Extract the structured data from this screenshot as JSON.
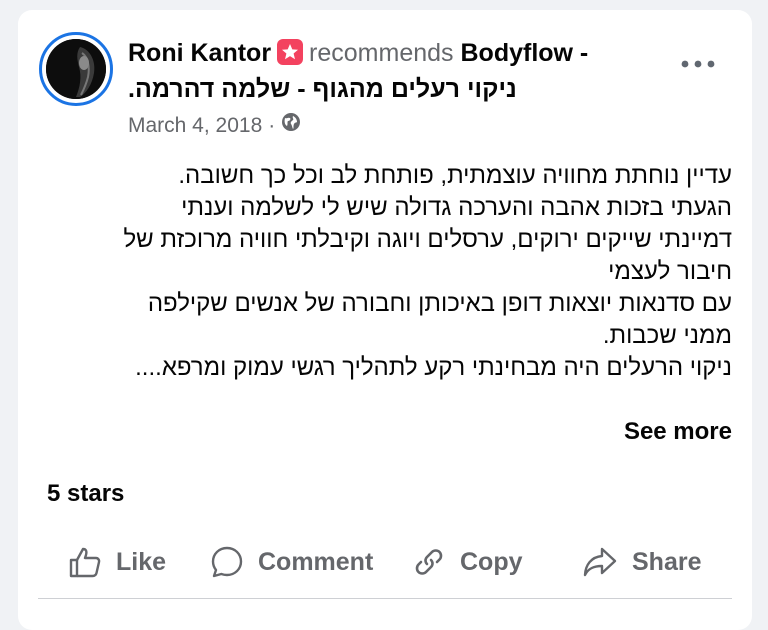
{
  "post": {
    "author": "Roni Kantor",
    "recommends_text": "recommends",
    "page_name_line1": "Bodyflow -",
    "page_name_line2": "ניקוי רעלים מהגוף - שלמה דהרמה.",
    "date": "March 4, 2018",
    "separator": "·",
    "privacy_icon": "globe-icon",
    "more_icon": "more-horizontal-icon",
    "body_lines": [
      "עדיין נוחתת מחוויה עוצמתית, פותחת לב וכל כך חשובה.",
      "הגעתי בזכות אהבה והערכה גדולה שיש לי לשלמה וענתי",
      "דמיינתי שייקים ירוקים, ערסלים ויוגה וקיבלתי חוויה מרוכזת של",
      "חיבור לעצמי",
      "עם סדנאות יוצאות דופן באיכותן וחבורה של אנשים שקילפה",
      "ממני שכבות.",
      "ניקוי הרעלים היה מבחינתי רקע לתהליך רגשי עמוק ומרפא...."
    ],
    "see_more": "See more",
    "rating": "5 stars"
  },
  "actions": {
    "like": "Like",
    "comment": "Comment",
    "copy": "Copy",
    "share": "Share"
  },
  "colors": {
    "accent": "#1b74e4",
    "recommend_badge": "#f3425f",
    "muted_text": "#65676b",
    "text": "#050505",
    "background": "#f0f2f5"
  }
}
